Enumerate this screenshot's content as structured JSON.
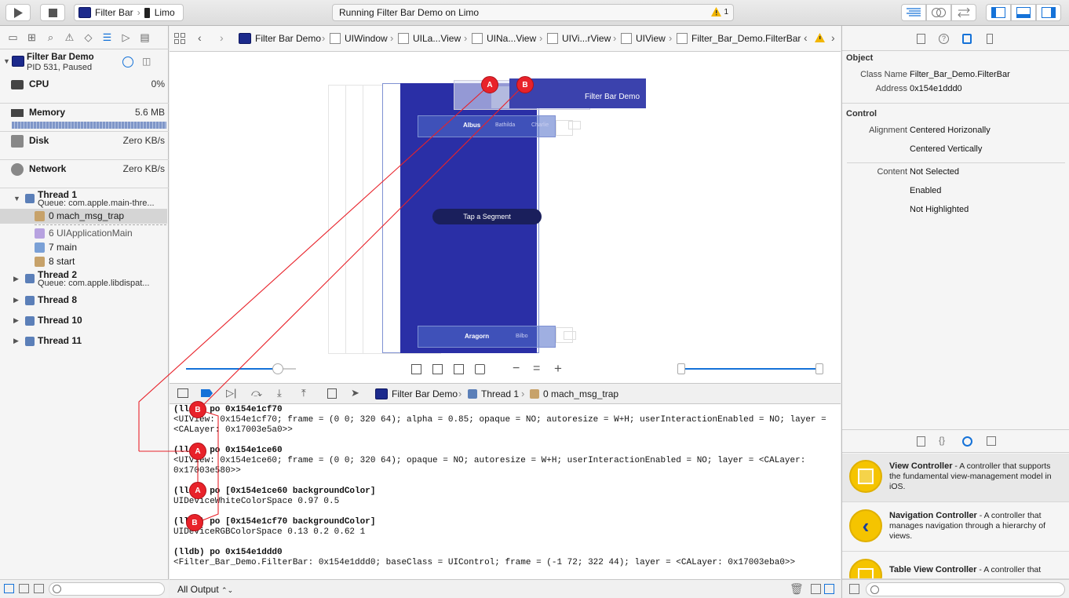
{
  "toolbar": {
    "scheme_app": "Filter Bar",
    "scheme_device": "Limo",
    "status_text": "Running Filter Bar Demo on Limo",
    "warning_count": "1"
  },
  "debug_nav": {
    "process_name": "Filter Bar Demo",
    "process_info": "PID 531, Paused",
    "gauges": [
      {
        "label": "CPU",
        "value": "0%"
      },
      {
        "label": "Memory",
        "value": "5.6 MB"
      },
      {
        "label": "Disk",
        "value": "Zero KB/s"
      },
      {
        "label": "Network",
        "value": "Zero KB/s"
      }
    ],
    "thread1_name": "Thread 1",
    "thread1_queue": "Queue: com.apple.main-thre...",
    "frames": [
      "0 mach_msg_trap",
      "6 UIApplicationMain",
      "7 main",
      "8 start"
    ],
    "thread2_name": "Thread 2",
    "thread2_queue": "Queue: com.apple.libdispat...",
    "other_threads": [
      "Thread 8",
      "Thread 10",
      "Thread 11"
    ]
  },
  "jumpbar": {
    "crumbs": [
      "Filter Bar Demo",
      "UIWindow",
      "UILa...View",
      "UINa...View",
      "UIVi...rView",
      "UIView",
      "Filter_Bar_Demo.FilterBar"
    ]
  },
  "canvas": {
    "nav_title": "Filter Bar Demo",
    "segments_top": [
      "Albus",
      "Bathilda",
      "Charlie"
    ],
    "center_label": "Tap a Segment",
    "segments_bottom": [
      "Aragorn",
      "Bilbo"
    ]
  },
  "debugbar": {
    "crumbs": [
      "Filter Bar Demo",
      "Thread 1",
      "0 mach_msg_trap"
    ]
  },
  "console": {
    "lines": [
      {
        "text": "(lldb) po 0x154e1cf70",
        "cmd": true
      },
      {
        "text": "<UIView: 0x154e1cf70; frame = (0 0; 320 64); alpha = 0.85; opaque = NO; autoresize = W+H; userInteractionEnabled = NO; layer =",
        "cmd": false
      },
      {
        "text": "<CALayer: 0x17003e5a0>>",
        "cmd": false
      },
      {
        "text": "",
        "cmd": false
      },
      {
        "text": "(lldb) po 0x154e1ce60",
        "cmd": true
      },
      {
        "text": "<UIView: 0x154e1ce60; frame = (0 0; 320 64); opaque = NO; autoresize = W+H; userInteractionEnabled = NO; layer = <CALayer:",
        "cmd": false
      },
      {
        "text": "0x17003e580>>",
        "cmd": false
      },
      {
        "text": "",
        "cmd": false
      },
      {
        "text": "(lldb) po [0x154e1ce60 backgroundColor]",
        "cmd": true
      },
      {
        "text": "UIDeviceWhiteColorSpace 0.97 0.5",
        "cmd": false
      },
      {
        "text": "",
        "cmd": false
      },
      {
        "text": "(lldb) po [0x154e1cf70 backgroundColor]",
        "cmd": true
      },
      {
        "text": "UIDeviceRGBColorSpace 0.13 0.2 0.62 1",
        "cmd": false
      },
      {
        "text": "",
        "cmd": false
      },
      {
        "text": "(lldb) po 0x154e1ddd0",
        "cmd": true
      },
      {
        "text": "<Filter_Bar_Demo.FilterBar: 0x154e1ddd0; baseClass = UIControl; frame = (-1 72; 322 44); layer = <CALayer: 0x17003eba0>>",
        "cmd": false
      }
    ],
    "output_filter": "All Output"
  },
  "inspector": {
    "object_title": "Object",
    "class_name_label": "Class Name",
    "class_name_value": "Filter_Bar_Demo.FilterBar",
    "address_label": "Address",
    "address_value": "0x154e1ddd0",
    "control_title": "Control",
    "alignment_label": "Alignment",
    "alignment_h": "Centered Horizonally",
    "alignment_v": "Centered Vertically",
    "content_label": "Content",
    "content_values": [
      "Not Selected",
      "Enabled",
      "Not Highlighted"
    ]
  },
  "library": [
    {
      "title": "View Controller",
      "desc": " - A controller that supports the fundamental view-management model in iOS."
    },
    {
      "title": "Navigation Controller",
      "desc": " - A controller that manages navigation through a hierarchy of views."
    },
    {
      "title": "Table View Controller",
      "desc": " - A controller that"
    }
  ],
  "annotations": {
    "a": "A",
    "b": "B"
  },
  "colors": {
    "accent": "#1572d8",
    "view_blue": "#2a2fa6",
    "badge_red": "#e8222a"
  }
}
